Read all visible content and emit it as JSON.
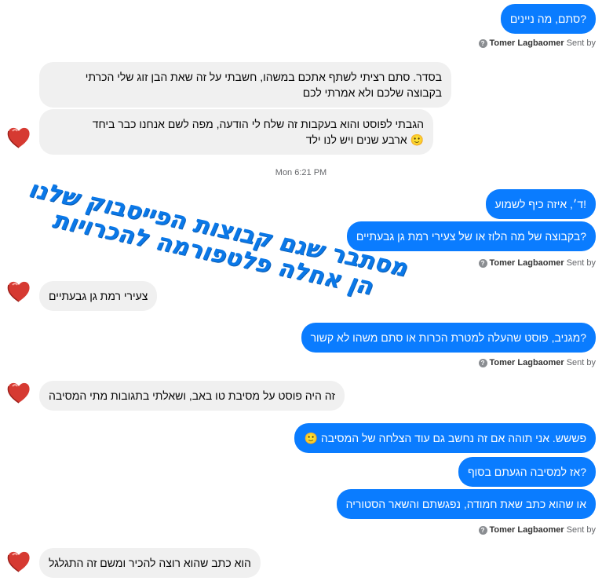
{
  "messages": {
    "m1": "?סתם, מה ניינים",
    "m2_line1": "בסדר. סתם רציתי לשתף אתכם במשהו, חשבתי על זה שאת הבן זוג שלי הכרתי",
    "m2_line2": "בקבוצה שלכם ולא אמרתי לכם",
    "m3_line1": "הגבתי לפוסט והוא בעקבות זה שלח לי הודעה, מפה לשם אנחנו כבר ביחד",
    "m3_line2": "ארבע שנים ויש לנו ילד",
    "m4": "!ד׳, איזה כיף לשמוע",
    "m5": "?בקבוצה של מה הלוז או של צעירי רמת גן גבעתיים",
    "m6": "צעירי רמת גן גבעתיים",
    "m7": "?מגניב, פוסט שהעלה למטרת הכרות או סתם משהו לא קשור",
    "m8": "זה היה פוסט על מסיבת טו באב, ושאלתי בתגובות מתי המסיבה",
    "m9": "פששש. אני תוהה אם זה נחשב גם עוד הצלחה של המסיבה",
    "m10": "?אז למסיבה הגעתם בסוף",
    "m11": "או שהוא כתב שאת חמודה, נפגשתם והשאר הסטוריה",
    "m12": "הוא כתב שהוא רוצה להכיר ומשם זה התגלגל"
  },
  "sent_by": {
    "prefix": "Sent by",
    "name": "Tomer Lagbaomer",
    "icon": "help-circle-icon",
    "icon_glyph": "?"
  },
  "timestamp": "Mon 6:21 PM",
  "overlay": {
    "line1": "מסתבר שגם קבוצות הפייסבוק שלנו",
    "line2": "הן אחלה פלטפורמה להכרויות"
  },
  "emoji": "🙂",
  "colors": {
    "outgoing": "#0a7cff",
    "incoming": "#f0f0f0",
    "overlay_text": "#0a78e8",
    "avatar_heart": "#e0453a"
  }
}
